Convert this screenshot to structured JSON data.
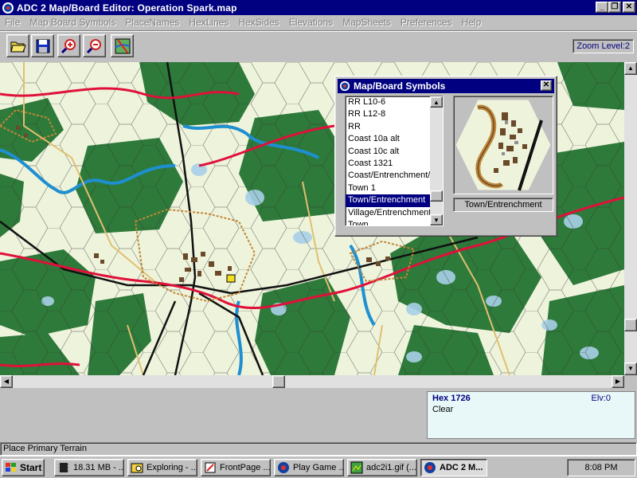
{
  "window": {
    "title": "ADC 2 Map/Board Editor: Operation Spark.map"
  },
  "menu": [
    "File",
    "Map Board Symbols",
    "PlaceNames",
    "HexLines",
    "HexSides",
    "Elevations",
    "MapSheets",
    "Preferences",
    "Help"
  ],
  "toolbar": {
    "buttons": [
      "open-icon",
      "save-icon",
      "zoom-in-icon",
      "zoom-out-icon",
      "map-view-icon"
    ],
    "zoom_label": "Zoom Level:2"
  },
  "symbols_dialog": {
    "title": "Map/Board Symbols",
    "items": [
      "RR L10-6",
      "RR L12-8",
      "RR",
      "Coast 10a alt",
      "Coast 10c alt",
      "Coast 1321",
      "Coast/Entrenchment/",
      "Town 1",
      "Town/Entrenchment",
      "Village/Entrenchment",
      "Town"
    ],
    "selected_index": 8,
    "preview_label": "Town/Entrenchment"
  },
  "info_panel": {
    "hex": "Hex 1726",
    "elevation": "Elv:0",
    "terrain": "Clear"
  },
  "status_text": "Place Primary Terrain",
  "taskbar": {
    "start": "Start",
    "tasks": [
      "18.31 MB - ...",
      "Exploring - ...",
      "FrontPage ...",
      "Play Game ...",
      "adc2i1.gif (...",
      "ADC 2 M..."
    ],
    "active_index": 5,
    "clock": "8:08 PM"
  },
  "colors": {
    "titlebar": "#000080",
    "forest": "#2e7a3a",
    "clear": "#eef3dc",
    "river": "#1e8fd0",
    "road_red": "#e0103a",
    "rail": "#111111",
    "town": "#c08838",
    "info_bg": "#e8f8f8"
  }
}
